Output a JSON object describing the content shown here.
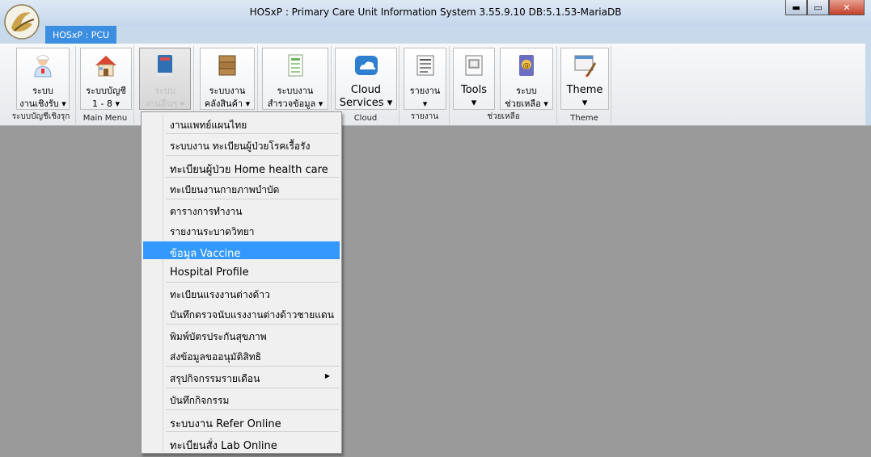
{
  "window": {
    "title": "HOSxP : Primary Care Unit Information System 3.55.9.10 DB:5.1.53-MariaDB",
    "minimize": "▬",
    "maximize": "▭",
    "close": "✕"
  },
  "tabs": [
    {
      "label": "HOSxP : PCU"
    }
  ],
  "ribbon": {
    "groups": [
      {
        "label": "ระบบบัญชีเชิงรุก",
        "buttons": [
          {
            "label": "ระบบ\nงานเชิงรับ ▾",
            "icon": "nurse-icon"
          }
        ]
      },
      {
        "label": "Main Menu",
        "buttons": [
          {
            "label": "ระบบบัญชี\n1 - 8 ▾",
            "icon": "house-icon"
          }
        ]
      },
      {
        "label": "",
        "buttons": [
          {
            "label": "ระบบ\nงานอื่นๆ ▾",
            "icon": "book-icon"
          }
        ]
      },
      {
        "label": "",
        "buttons": [
          {
            "label": "ระบบงาน\nคลังสินค้า ▾",
            "icon": "boxes-icon"
          }
        ]
      },
      {
        "label": "",
        "buttons": [
          {
            "label": "ระบบงาน\nสำรวจข้อมูล ▾",
            "icon": "survey-icon"
          }
        ]
      },
      {
        "label": "Cloud",
        "buttons": [
          {
            "label": "Cloud\nServices ▾",
            "icon": "cloud-icon"
          }
        ]
      },
      {
        "label": "รายงาน",
        "buttons": [
          {
            "label": "รายงาน\n▾",
            "icon": "report-icon"
          }
        ]
      },
      {
        "label": "ช่วยเหลือ",
        "buttons": [
          {
            "label": "Tools\n▾",
            "icon": "tools-icon"
          },
          {
            "label": "ระบบ\nช่วยเหลือ ▾",
            "icon": "help-icon"
          }
        ]
      },
      {
        "label": "Theme",
        "buttons": [
          {
            "label": "Theme\n▾",
            "icon": "theme-icon"
          }
        ]
      }
    ]
  },
  "menu": {
    "items": [
      {
        "label": "งานแพทย์แผนไทย"
      },
      {
        "label": "ระบบงาน ทะเบียนผู้ป่วยโรคเรื้อรัง"
      },
      {
        "label": "ทะเบียนผู้ป่วย Home health care"
      },
      {
        "label": "ทะเบียนงานกายภาพบำบัด"
      },
      {
        "label": "ตารางการทำงาน"
      },
      {
        "label": "รายงานระบาดวิทยา"
      },
      {
        "label": "ข้อมูล Vaccine"
      },
      {
        "label": "Hospital Profile"
      },
      {
        "label": "ทะเบียนแรงงานต่างด้าว"
      },
      {
        "label": "บันทึกตรวจนับแรงงานต่างด้าวชายแดน"
      },
      {
        "label": "พิมพ์บัตรประกันสุขภาพ"
      },
      {
        "label": "ส่งข้อมูลขออนุมัติสิทธิ"
      },
      {
        "label": "สรุปกิจกรรมรายเดือน",
        "submenu_arrow": "▶"
      },
      {
        "label": "บันทึกกิจกรรม"
      },
      {
        "label": "ระบบงาน Refer Online"
      },
      {
        "label": "ทะเบียนสั่ง Lab Online"
      }
    ]
  },
  "colors": {
    "selection": "#3399ff",
    "tab_active": "#3b8ee0",
    "desktop": "#9a9a9a"
  }
}
